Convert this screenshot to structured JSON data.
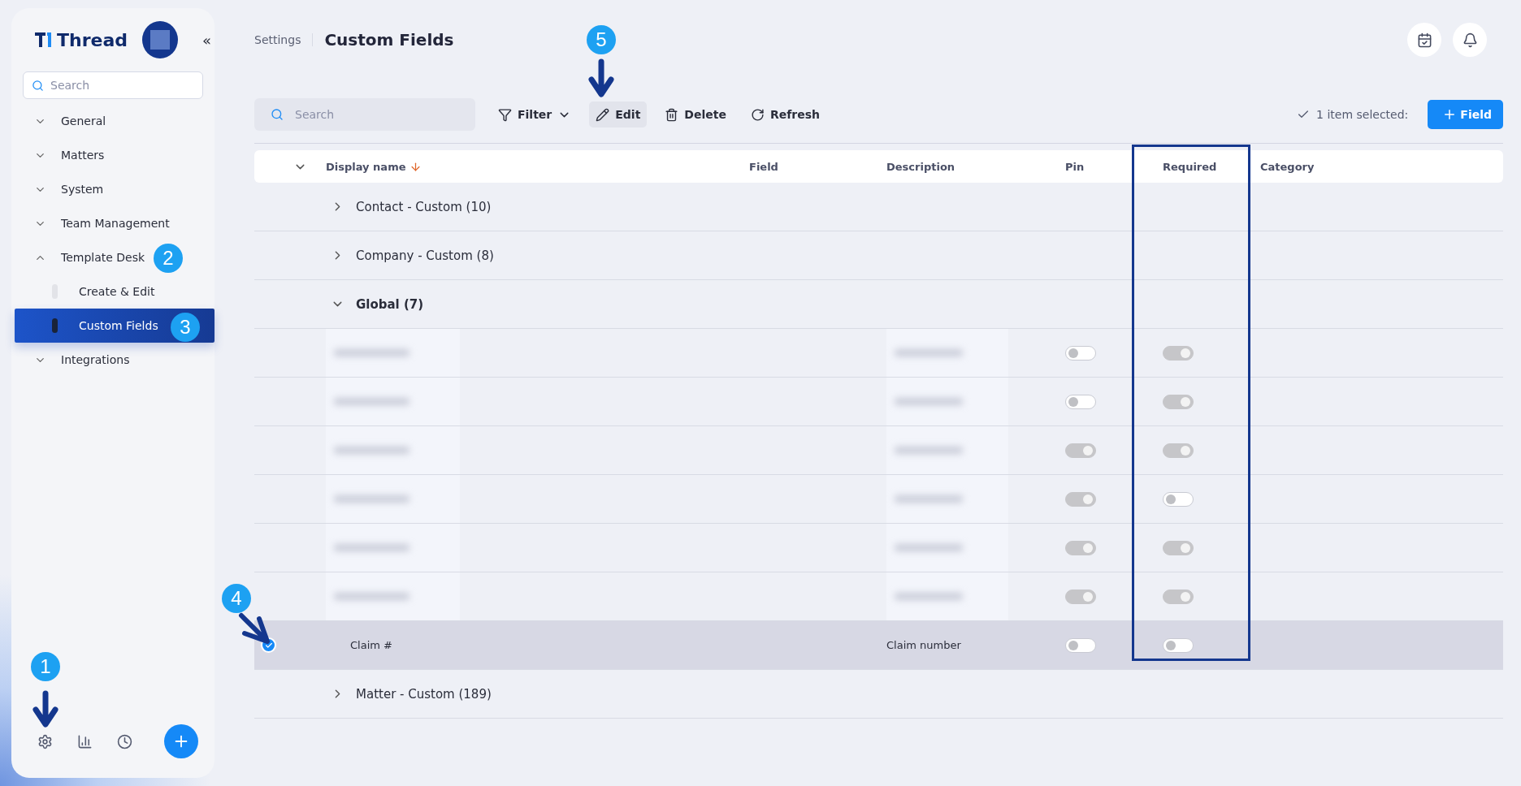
{
  "sidebar": {
    "logo": "Thread",
    "collapse": "«",
    "search": {
      "placeholder": "Search"
    },
    "nav": [
      {
        "label": "General",
        "expanded": false
      },
      {
        "label": "Matters",
        "expanded": false
      },
      {
        "label": "System",
        "expanded": false
      },
      {
        "label": "Team Management",
        "expanded": false
      },
      {
        "label": "Template Desk",
        "expanded": true,
        "children": [
          {
            "label": "Create & Edit",
            "selected": false
          },
          {
            "label": "Custom Fields",
            "selected": true
          }
        ]
      },
      {
        "label": "Integrations",
        "expanded": false
      }
    ]
  },
  "header": {
    "breadcrumb": "Settings",
    "title": "Custom Fields"
  },
  "toolbar": {
    "search": {
      "placeholder": "Search"
    },
    "actions": [
      {
        "kind": "filter",
        "label": "Filter",
        "hovered": false
      },
      {
        "kind": "edit",
        "label": "Edit",
        "hovered": true
      },
      {
        "kind": "delete",
        "label": "Delete",
        "hovered": false
      },
      {
        "kind": "refresh",
        "label": "Refresh",
        "hovered": false
      }
    ],
    "selection_status": "1 item selected:",
    "add_button": "Field"
  },
  "table": {
    "columns": [
      "Display name",
      "Field",
      "Description",
      "Pin",
      "Required",
      "Category"
    ],
    "groups": [
      {
        "label": "Contact - Custom (10)",
        "expanded": false
      },
      {
        "label": "Company - Custom (8)",
        "expanded": false
      },
      {
        "label": "Global (7)",
        "expanded": true,
        "rows": [
          {
            "kind": "blurred",
            "pin": false,
            "required": true,
            "selected": false
          },
          {
            "kind": "blurred",
            "pin": false,
            "required": true,
            "selected": false
          },
          {
            "kind": "blurred",
            "pin": true,
            "required": true,
            "selected": false
          },
          {
            "kind": "blurred",
            "pin": true,
            "required": false,
            "selected": false
          },
          {
            "kind": "blurred",
            "pin": true,
            "required": true,
            "selected": false
          },
          {
            "kind": "blurred",
            "pin": true,
            "required": true,
            "selected": false
          },
          {
            "kind": "field",
            "display_name": "Claim #",
            "description": "Claim number",
            "pin": false,
            "required": false,
            "selected": true
          }
        ]
      },
      {
        "label": "Matter - Custom (189)",
        "expanded": false
      }
    ]
  },
  "annotations": [
    "1",
    "2",
    "3",
    "4",
    "5"
  ]
}
